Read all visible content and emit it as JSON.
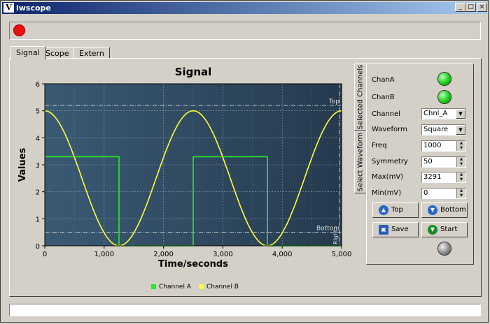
{
  "window": {
    "title": "iwscope",
    "icon_text": "V"
  },
  "titlebar_buttons": {
    "minimize": "_",
    "maximize": "□",
    "close": "×"
  },
  "tabs": [
    {
      "label": "Signal"
    },
    {
      "label": "Scope"
    },
    {
      "label": "Extern"
    }
  ],
  "side_tabs": [
    {
      "label": "Selected Channels"
    },
    {
      "label": "Select Waveform"
    }
  ],
  "controls": {
    "chan_a_label": "ChanA",
    "chan_b_label": "ChanB",
    "channel_label": "Channel",
    "channel_value": "Chnl_A",
    "waveform_label": "Waveform",
    "waveform_value": "Square",
    "freq_label": "Freq",
    "freq_value": "1000",
    "symmetry_label": "Symmetry",
    "symmetry_value": "50",
    "max_label": "Max(mV)",
    "max_value": "3291",
    "min_label": "Min(mV)",
    "min_value": "0",
    "top_button": "Top",
    "bottom_button": "Bottom",
    "save_button": "Save",
    "start_button": "Start"
  },
  "colors": {
    "chan_a": "#22ee22",
    "chan_b": "#ffff33",
    "plot_bg_left": "#3a5a74",
    "plot_bg_right": "#263a4e",
    "marker": "#dddddd"
  },
  "chart_data": {
    "type": "line",
    "title": "Signal",
    "xlabel": "Time/seconds",
    "ylabel": "Values",
    "xlim": [
      0,
      5000
    ],
    "ylim": [
      0,
      6
    ],
    "x_ticks": [
      0,
      1000,
      2000,
      3000,
      4000,
      5000
    ],
    "x_tick_labels": [
      "0",
      "1,000",
      "2,000",
      "3,000",
      "4,000",
      "5,000"
    ],
    "y_ticks": [
      0,
      1,
      2,
      3,
      4,
      5,
      6
    ],
    "y_tick_labels": [
      "0",
      "1",
      "2",
      "3",
      "4",
      "5",
      "6"
    ],
    "grid": true,
    "legend": "bottom",
    "markers": [
      {
        "label": "Top",
        "y": 5.2
      },
      {
        "label": "Bottom",
        "y": 0.5
      }
    ],
    "right_axis_label": "Right",
    "series": [
      {
        "name": "Channel A",
        "kind": "square",
        "period": 2500,
        "high": 3.3,
        "low": 0,
        "high_first_until": 1250,
        "x": [
          0,
          1250,
          1250,
          2500,
          2500,
          3750,
          3750,
          5000
        ],
        "y": [
          3.3,
          3.3,
          0,
          0,
          3.3,
          3.3,
          0,
          0
        ]
      },
      {
        "name": "Channel B",
        "kind": "cosine",
        "period": 2500,
        "amplitude": 2.5,
        "offset": 2.5,
        "x": [
          0,
          625,
          1250,
          1875,
          2500,
          3125,
          3750,
          4375,
          5000
        ],
        "y": [
          5,
          2.5,
          0,
          2.5,
          5,
          2.5,
          0,
          2.5,
          5
        ]
      }
    ]
  }
}
